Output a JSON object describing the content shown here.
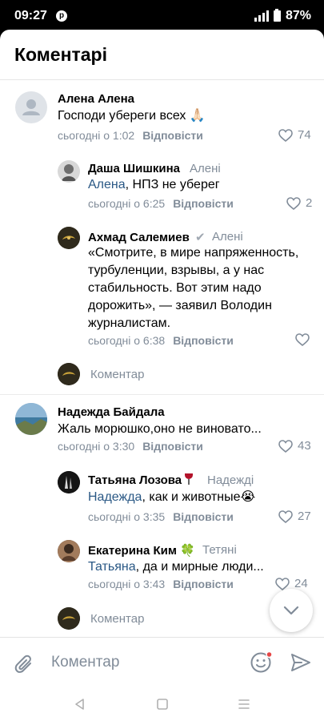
{
  "status_bar": {
    "time": "09:27",
    "battery": "87%"
  },
  "header": {
    "title": "Коментарі"
  },
  "comments": [
    {
      "name": "Алена Алена",
      "reply_to": "",
      "text": "Господи убереги всех 🙏🏻",
      "time": "сьогодні о 1:02",
      "reply_label": "Відповісти",
      "likes": "74"
    },
    {
      "name": "Даша Шишкина",
      "reply_to": "Алені",
      "mention": "Алена",
      "text": ", НПЗ не уберег",
      "time": "сьогодні о 6:25",
      "reply_label": "Відповісти",
      "likes": "2"
    },
    {
      "name": "Ахмад Салемиев",
      "reply_to": "Алені",
      "text_lines": [
        "«Смотрите, в мире напряженность,",
        "турбуленции, взрывы, а у нас",
        "стабильность. Вот этим надо",
        "дорожить», — заявил Володин",
        "журналистам."
      ],
      "time": "сьогодні о 6:38",
      "reply_label": "Відповісти",
      "likes": ""
    },
    {
      "name": "Надежда Байдала",
      "reply_to": "",
      "text": "Жаль морюшко,оно не виновато...",
      "time": "сьогодні о 3:30",
      "reply_label": "Відповісти",
      "likes": "43"
    },
    {
      "name": "Татьяна Лозова",
      "reply_to": "Надежді",
      "mention": "Надежда",
      "text": ", как и животные😭",
      "time": "сьогодні о 3:35",
      "reply_label": "Відповісти",
      "likes": "27"
    },
    {
      "name": "Екатерина Ким",
      "name_emoji": "🍀",
      "reply_to": "Тетяні",
      "mention": "Татьяна",
      "text": ", да и мирные люди...",
      "time": "сьогодні о 3:43",
      "reply_label": "Відповісти",
      "likes": "24"
    }
  ],
  "thread_reply_placeholder": "Коментар",
  "composer": {
    "placeholder": "Коментар"
  }
}
